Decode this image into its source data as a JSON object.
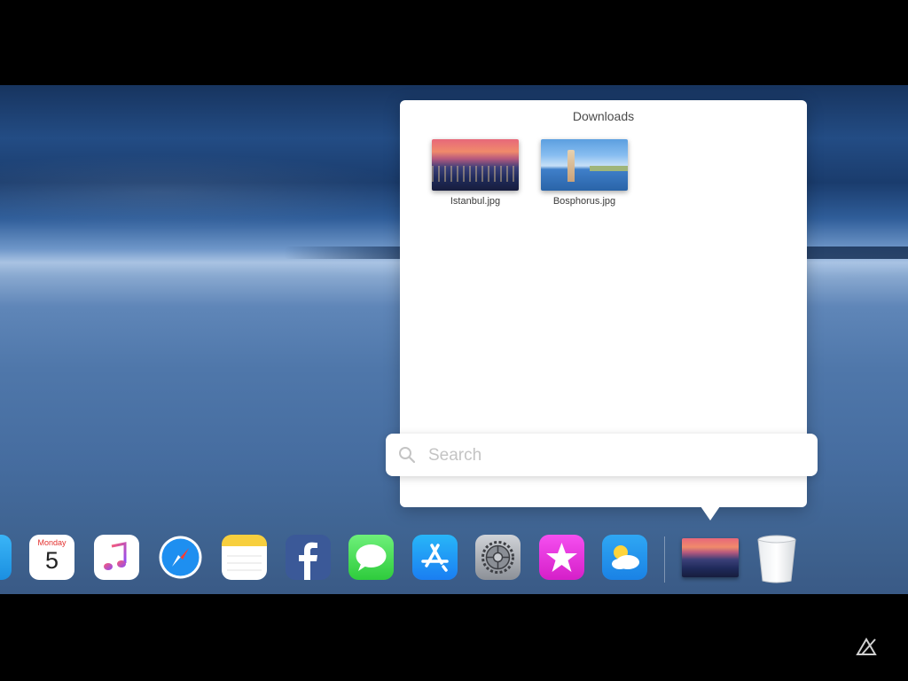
{
  "downloads": {
    "title": "Downloads",
    "files": [
      {
        "name": "Istanbul.jpg"
      },
      {
        "name": "Bosphorus.jpg"
      }
    ]
  },
  "search": {
    "placeholder": "Search",
    "value": ""
  },
  "dock": {
    "calendar": {
      "weekday": "Monday",
      "day": "5"
    },
    "items": [
      "mail-icon",
      "calendar-icon",
      "music-icon",
      "safari-icon",
      "notes-icon",
      "facebook-icon",
      "messages-icon",
      "app-store-icon",
      "settings-icon",
      "itunes-store-icon",
      "weather-icon",
      "downloads-stack",
      "trash-icon"
    ]
  },
  "colors": {
    "panel_bg": "#ffffff",
    "desktop_sky": "#234c84",
    "calendar_red": "#e3302e"
  }
}
